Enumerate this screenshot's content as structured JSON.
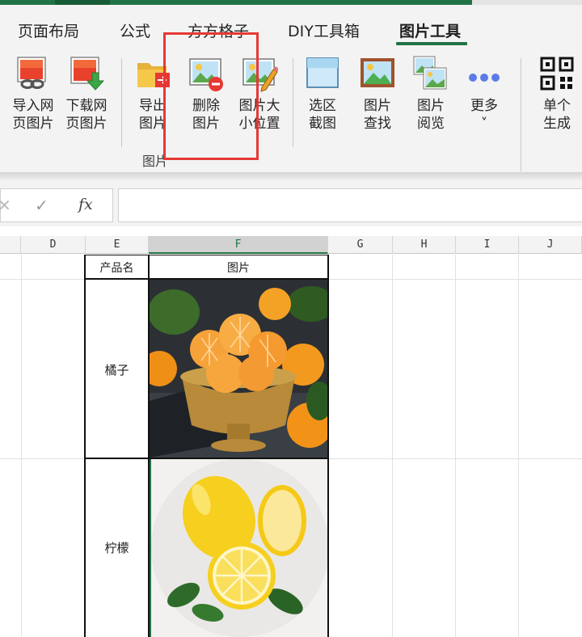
{
  "tabs": [
    {
      "label": "页面布局",
      "active": false
    },
    {
      "label": "公式",
      "active": false
    },
    {
      "label": "方方格子",
      "active": false
    },
    {
      "label": "DIY工具箱",
      "active": false
    },
    {
      "label": "图片工具",
      "active": true
    }
  ],
  "ribbon": {
    "group_label": "图片",
    "buttons": [
      {
        "id": "import-web-image",
        "label": "导入网\n页图片",
        "icon": "web-image-link-icon"
      },
      {
        "id": "download-web-image",
        "label": "下载网\n页图片",
        "icon": "download-image-icon"
      },
      {
        "id": "export-image",
        "label": "导出\n图片",
        "icon": "folder-export-icon"
      },
      {
        "id": "delete-image",
        "label": "删除\n图片",
        "icon": "image-delete-icon"
      },
      {
        "id": "image-size-position",
        "label": "图片大\n小位置",
        "icon": "image-edit-icon"
      },
      {
        "id": "select-screenshot",
        "label": "选区\n截图",
        "icon": "selection-screenshot-icon"
      },
      {
        "id": "find-image",
        "label": "图片\n查找",
        "icon": "image-find-icon"
      },
      {
        "id": "browse-image",
        "label": "图片\n阅览",
        "icon": "image-gallery-icon"
      },
      {
        "id": "more",
        "label": "更多\n˅",
        "icon": "more-dots-icon"
      },
      {
        "id": "single-generate",
        "label": "单个\n生成",
        "icon": "qr-code-icon"
      }
    ]
  },
  "formula_bar": {
    "cancel_icon": "close-icon",
    "enter_icon": "check-icon",
    "fx_label": "fx",
    "value": ""
  },
  "columns": [
    "D",
    "E",
    "F",
    "G",
    "H",
    "I",
    "J"
  ],
  "selected_column": "F",
  "sheet": {
    "header_product": "产品名",
    "header_image": "图片",
    "rows": [
      {
        "product": "橘子",
        "image": "orange-photo"
      },
      {
        "product": "柠檬",
        "image": "lemon-photo"
      }
    ]
  },
  "colors": {
    "accent": "#217346",
    "highlight": "#e53935"
  }
}
